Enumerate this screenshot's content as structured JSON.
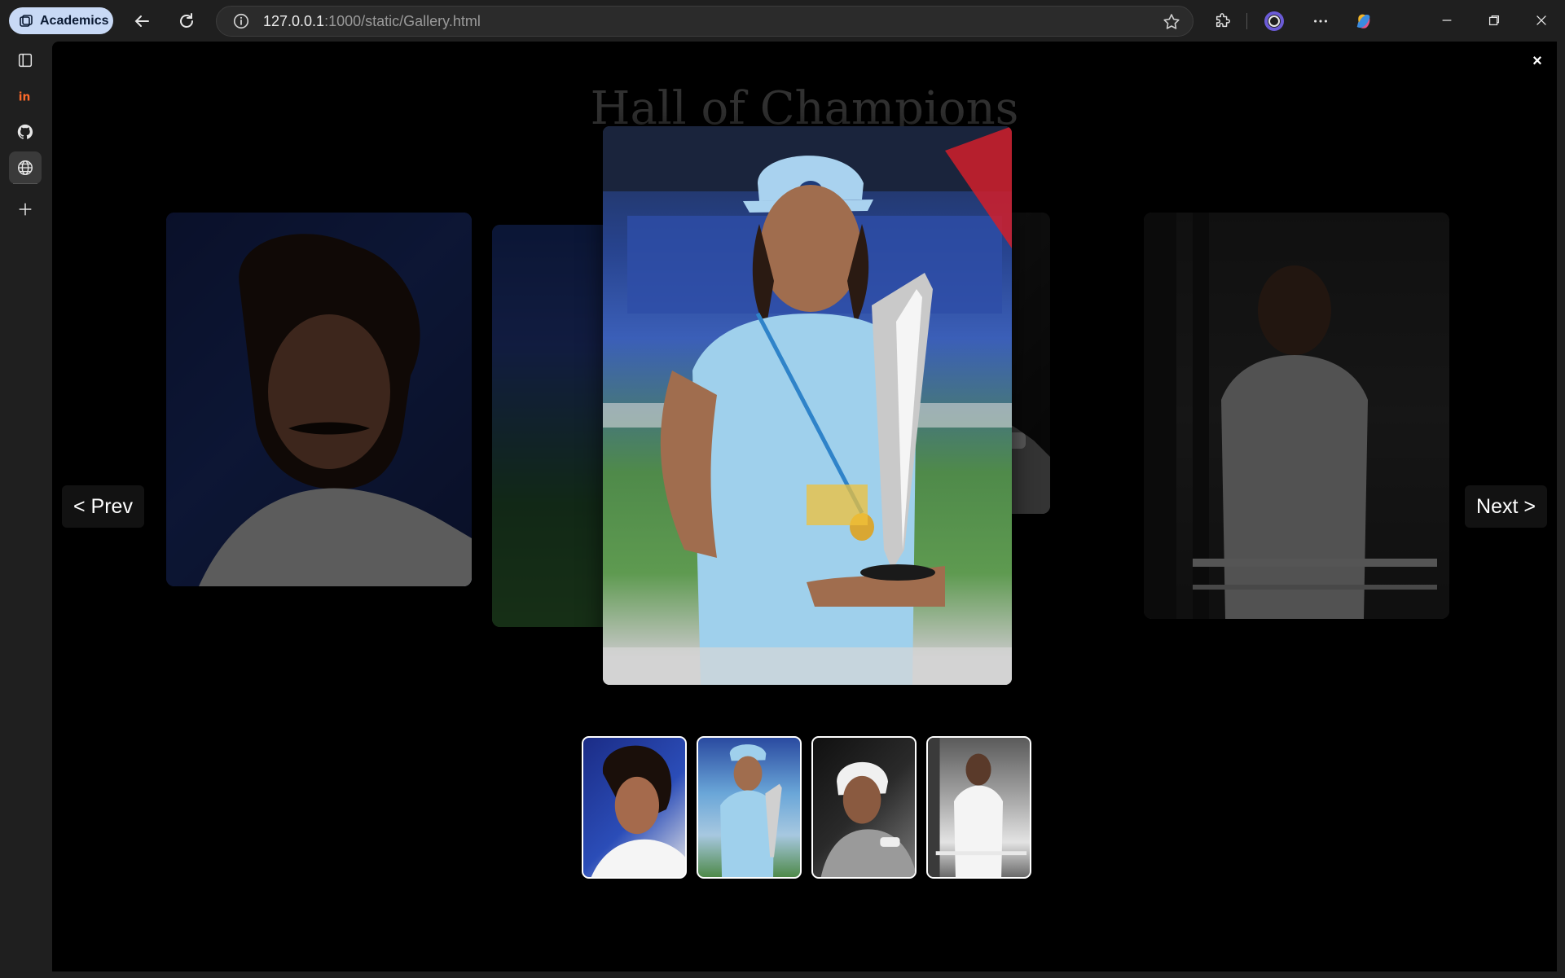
{
  "browser": {
    "profile_label": "Academics",
    "url_host": "127.0.0.1",
    "url_rest": ":1000/static/Gallery.html"
  },
  "sidebar": {
    "items": [
      {
        "name": "sidebar-panel-icon"
      },
      {
        "name": "invision-icon"
      },
      {
        "name": "github-icon"
      },
      {
        "name": "globe-icon"
      },
      {
        "name": "add-icon"
      }
    ]
  },
  "gallery": {
    "title": "Hall of Champions",
    "close_label": "×",
    "prev_label": "< Prev",
    "next_label": "Next >",
    "thumbnails_count": 4
  },
  "colors": {
    "accent_pill": "#c8d9f5",
    "page_bg": "#000000",
    "chrome_bg": "#1f1f1f"
  }
}
